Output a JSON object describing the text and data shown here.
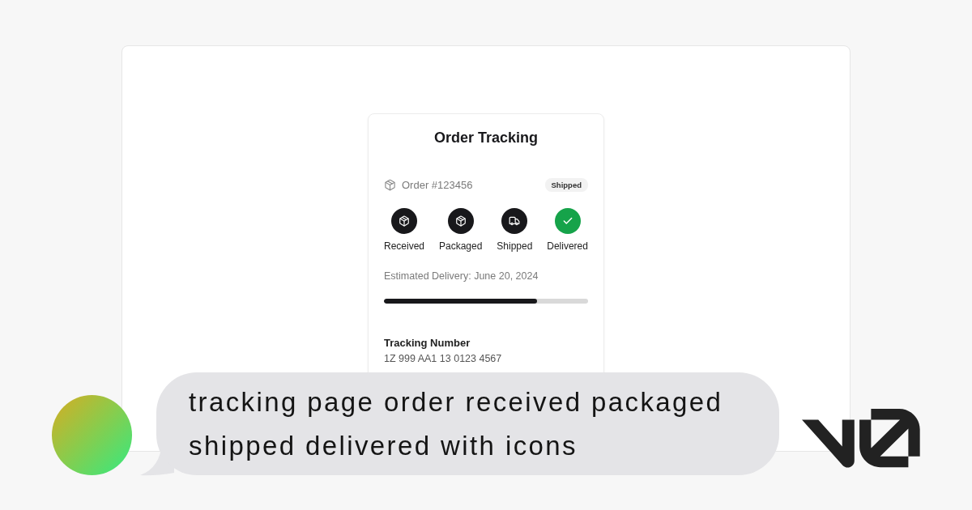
{
  "frame": {
    "card": {
      "title": "Order Tracking",
      "order": {
        "number": "Order #123456",
        "status_badge": "Shipped"
      },
      "steps": [
        {
          "label": "Received",
          "kind": "box",
          "color": "#18181b"
        },
        {
          "label": "Packaged",
          "kind": "box",
          "color": "#18181b"
        },
        {
          "label": "Shipped",
          "kind": "truck",
          "color": "#18181b"
        },
        {
          "label": "Delivered",
          "kind": "check",
          "color": "#16a34a"
        }
      ],
      "estimated_delivery": "Estimated Delivery: June 20, 2024",
      "progress": {
        "level": 0.75
      },
      "tracking": {
        "label": "Tracking Number",
        "value": "1Z 999 AA1 13 0123 4567"
      }
    }
  },
  "prompt": {
    "text": "tracking page order received packaged shipped delivered with icons"
  }
}
